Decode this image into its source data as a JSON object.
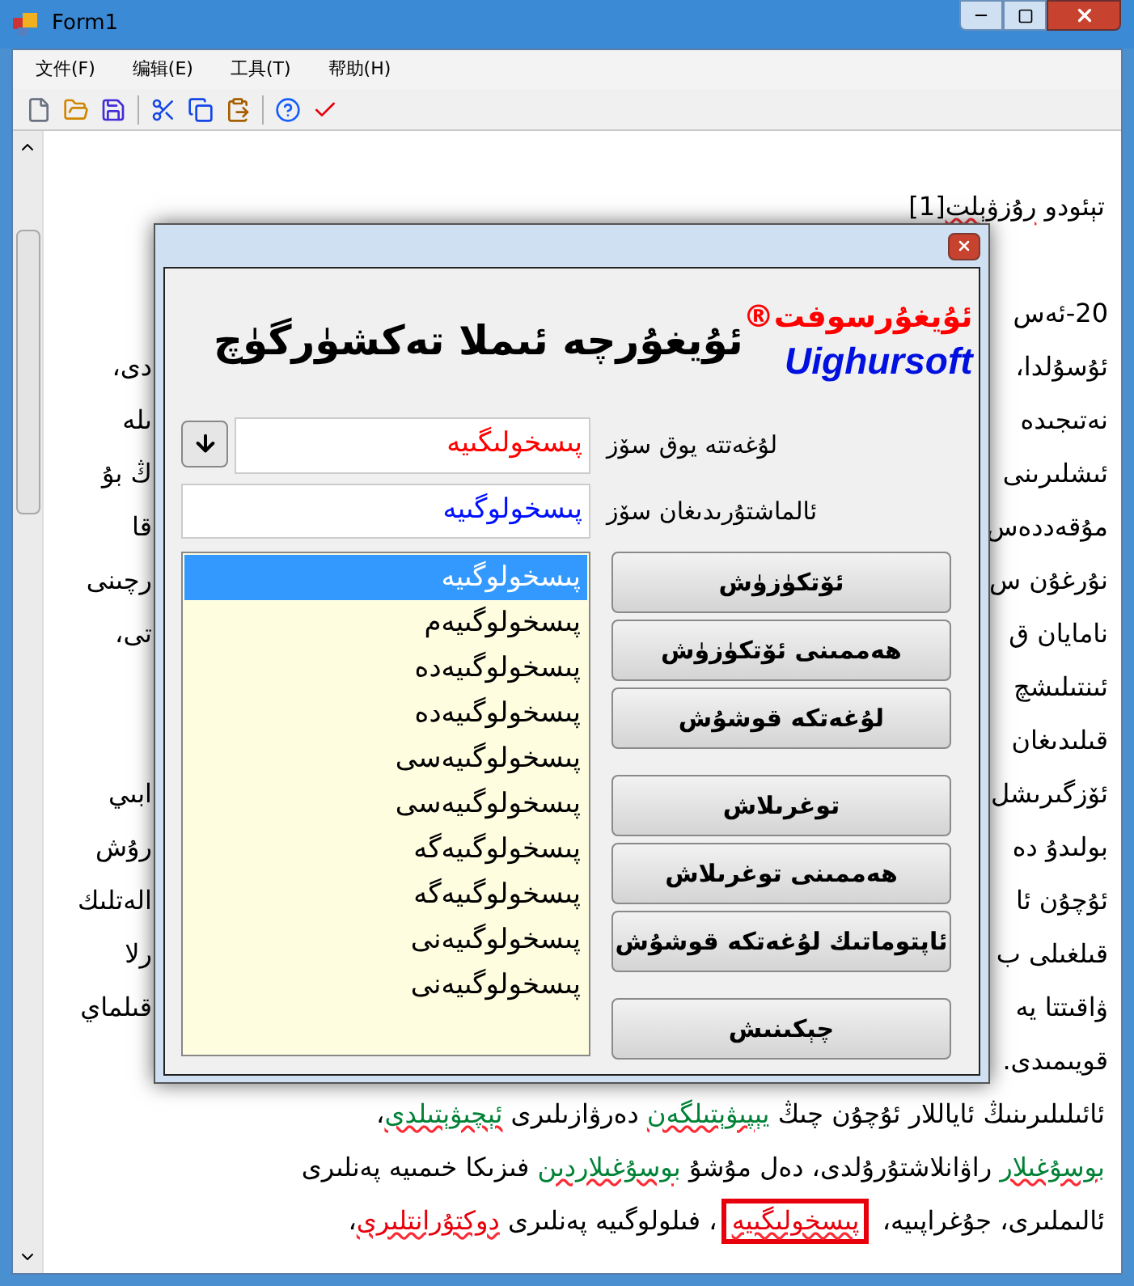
{
  "window": {
    "title": "Form1"
  },
  "menu": {
    "file": "文件(F)",
    "edit": "编辑(E)",
    "tools": "工具(T)",
    "help": "帮助(H)"
  },
  "toolbar": [
    {
      "kind": "new"
    },
    {
      "kind": "open"
    },
    {
      "kind": "save"
    },
    {
      "kind": "separator"
    },
    {
      "kind": "cut"
    },
    {
      "kind": "copy"
    },
    {
      "kind": "paste"
    },
    {
      "kind": "separator"
    },
    {
      "kind": "help"
    },
    {
      "kind": "spell"
    }
  ],
  "document": {
    "heading": [
      {
        "text": "تېئودو ",
        "kind": "plain"
      },
      {
        "text": "رۇزۋېلت",
        "kind": "unknown"
      },
      {
        "text": "[1]",
        "kind": "plain"
      }
    ],
    "lines": [
      {
        "right": "20-ئەس"
      },
      {
        "right": "ئۇسۇلدا،",
        "left": "دى،"
      },
      {
        "right": "نەتىجىدە",
        "left": "ىلە"
      },
      {
        "right": "ئىشلىرىنى",
        "left": "ڭ بۇ"
      },
      {
        "right": "مۇقەددەس",
        "left": "قا"
      },
      {
        "right": "نۇرغۇن س",
        "left": "رچىنى"
      },
      {
        "right": "نامايان ق",
        "left": "تى،"
      },
      {
        "right": "ئىنتىلىشچ"
      },
      {
        "right": "قىلىدىغان"
      },
      {
        "right": "ئۆزگىرىشل",
        "left": "ابىي"
      },
      {
        "right": "بولىدۇ دە",
        "left": "رۇش"
      },
      {
        "right": "ئۇچۇن ئا",
        "left": "الەتلىك"
      },
      {
        "right": "قىلغىلى ب",
        "left": "رلا"
      },
      {
        "right": "ۋاقىتتا يە",
        "left": "قىلماي"
      },
      {
        "right": "قويىمىدى."
      },
      {
        "segments": [
          {
            "text": "ئائىلىلىرىنىڭ ئاياللار ئۇچۇن چىڭ ",
            "kind": "plain"
          },
          {
            "text": "يېپىۋېتىلگەن",
            "kind": "suggested"
          },
          {
            "text": " دەرۋازىلىرى ",
            "kind": "plain"
          },
          {
            "text": "ئېچىۋېتىلدى",
            "kind": "suggested"
          },
          {
            "text": "،",
            "kind": "plain"
          }
        ]
      },
      {
        "segments": [
          {
            "text": "بوسۇغىلار",
            "kind": "suggested"
          },
          {
            "text": " راۋانلاشتۇرۇلدى، دەل مۇشۇ ",
            "kind": "plain"
          },
          {
            "text": "بوسۇغىلاردىن",
            "kind": "suggested"
          },
          {
            "text": " فىزىكا خىمىيە پەنلىرى",
            "kind": "plain"
          }
        ]
      },
      {
        "segments": [
          {
            "text": "ئالىملىرى، جۇغراپىيە، ",
            "kind": "plain"
          },
          {
            "text": "پىسخولىگىيە",
            "kind": "current"
          },
          {
            "text": "، فىلولوگىيە پەنلىرى ",
            "kind": "plain"
          },
          {
            "text": "دوكتۇرانتلىرى",
            "kind": "error"
          },
          {
            "text": "،",
            "kind": "plain"
          }
        ]
      }
    ]
  },
  "dialog": {
    "heading": "ئۇيغۇرچە ئىملا تەكشۈرگۈچ",
    "logo_name": "ئۇيغۇرسوفت",
    "logo_mark": "®",
    "logo_latin": "Uighursoft",
    "unknown_label": "لۇغەتتە يوق سۆز",
    "unknown_word": "پىسخولىگىيە",
    "replace_label": "ئالماشتۇرىدىغان سۆز",
    "replace_word": "پىسخولوگىيە",
    "suggestions": [
      {
        "text": "پىسخولوگىيە",
        "selected": true
      },
      {
        "text": "پىسخولوگىيەم",
        "selected": false
      },
      {
        "text": "پىسخولوگىيەدە",
        "selected": false
      },
      {
        "text": "پىسخولوگىيەدە",
        "selected": false
      },
      {
        "text": "پىسخولوگىيەسى",
        "selected": false
      },
      {
        "text": "پىسخولوگىيەسى",
        "selected": false
      },
      {
        "text": "پىسخولوگىيەگە",
        "selected": false
      },
      {
        "text": "پىسخولوگىيەگە",
        "selected": false
      },
      {
        "text": "پىسخولوگىيەنى",
        "selected": false
      },
      {
        "text": "پىسخولوگىيەنى",
        "selected": false
      }
    ],
    "button_groups": [
      [
        "ئۆتكۈزۈش",
        "ھەممىنى ئۆتكۈزۈش",
        "لۇغەتكە قوشۇش"
      ],
      [
        "توغرىلاش",
        "ھەممىنى توغرىلاش",
        "ئاپتوماتىك لۇغەتكە قوشۇش"
      ],
      [
        "چېكىنىش"
      ]
    ]
  }
}
